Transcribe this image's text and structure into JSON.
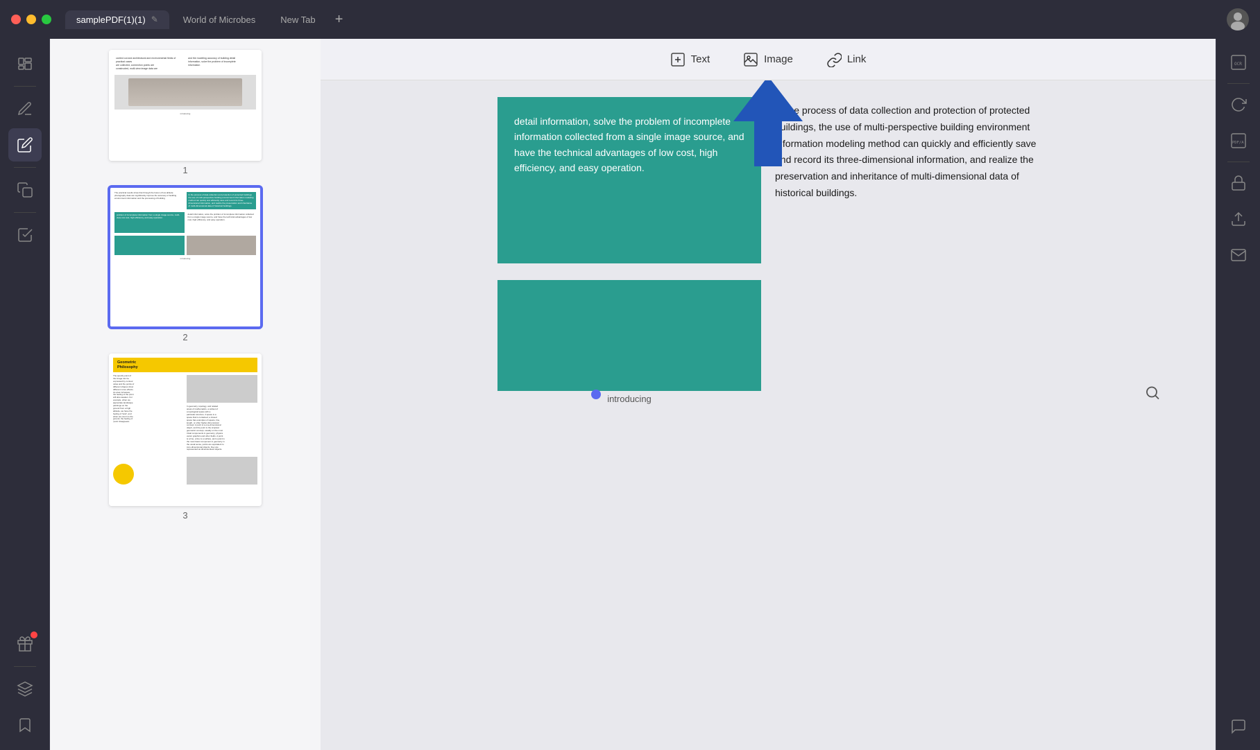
{
  "titleBar": {
    "tabs": [
      {
        "id": "tab-pdf",
        "label": "samplePDF(1)(1)",
        "active": true
      },
      {
        "id": "tab-microbes",
        "label": "World of Microbes",
        "active": false
      },
      {
        "id": "tab-newtab",
        "label": "New Tab",
        "active": false
      }
    ],
    "addTabLabel": "+",
    "editIcon": "✎"
  },
  "leftSidebar": {
    "icons": [
      {
        "id": "pages-icon",
        "symbol": "☰",
        "active": false
      },
      {
        "id": "edit-icon",
        "symbol": "✎",
        "active": false
      },
      {
        "id": "annotate-icon",
        "symbol": "🖊",
        "active": true
      },
      {
        "id": "copy-icon",
        "symbol": "⧉",
        "active": false
      },
      {
        "id": "form-icon",
        "symbol": "☑",
        "active": false
      }
    ],
    "bottomIcons": [
      {
        "id": "gift-icon",
        "symbol": "🎁",
        "hasNotification": true
      },
      {
        "id": "layers-icon",
        "symbol": "⊞",
        "active": false
      },
      {
        "id": "bookmark-icon",
        "symbol": "🔖",
        "active": false
      }
    ]
  },
  "toolbar": {
    "buttons": [
      {
        "id": "text-btn",
        "label": "Text",
        "iconType": "text"
      },
      {
        "id": "image-btn",
        "label": "Image",
        "iconType": "image"
      },
      {
        "id": "link-btn",
        "label": "Link",
        "iconType": "link"
      }
    ],
    "searchIcon": "🔍"
  },
  "thumbnails": [
    {
      "pageNum": "1",
      "selected": false
    },
    {
      "pageNum": "2",
      "selected": true
    },
    {
      "pageNum": "3",
      "selected": false
    }
  ],
  "pageContent": {
    "tealBoxText": "detail information, solve the problem of incomplete information collected from a single image source, and have the technical advantages of low cost, high efficiency, and easy operation.",
    "rightText": "In the process of data collection and protection of protected buildings, the use of multi-perspective building environment information modeling method can quickly and efficiently save and record its three-dimensional information, and realize the preservation and inheritance of multi-dimensional data of historical buildings.",
    "introducingLabel": "introducing"
  },
  "rightSidebar": {
    "icons": [
      {
        "id": "ocr-icon",
        "label": "OCR"
      },
      {
        "id": "refresh-icon",
        "label": "⟳"
      },
      {
        "id": "pdfa-icon",
        "label": "PDF/A"
      },
      {
        "id": "protect-icon",
        "label": "🔒"
      },
      {
        "id": "share-icon",
        "label": "⬆"
      },
      {
        "id": "mail-icon",
        "label": "✉"
      }
    ],
    "commentIcon": "💬"
  }
}
